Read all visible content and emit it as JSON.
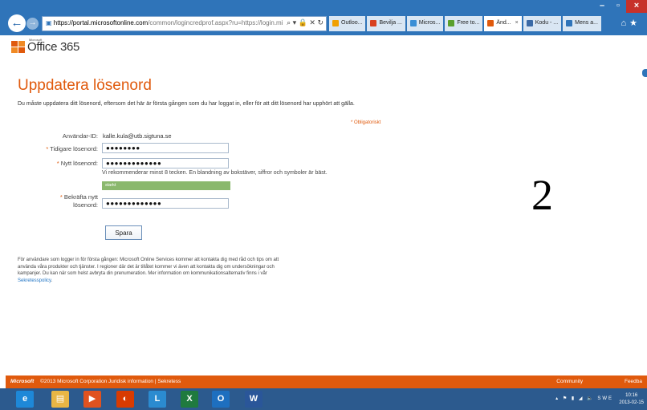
{
  "browser": {
    "url_host": "https://portal.microsoftonline.com",
    "url_rest": "/common/logincredprof.aspx?ru=https://login.mi",
    "tabs": [
      {
        "label": "Outloo...",
        "color": "#f0a000"
      },
      {
        "label": "Bevilja ...",
        "color": "#d8401f"
      },
      {
        "label": "Micros...",
        "color": "#3a8fd6"
      },
      {
        "label": "Free to...",
        "color": "#5aa02c"
      },
      {
        "label": "Änd...",
        "color": "#e05a0d"
      },
      {
        "label": "Kodu - ...",
        "color": "#3b6aa6"
      },
      {
        "label": "Mens a...",
        "color": "#2f74b9"
      }
    ],
    "tab_close": "×"
  },
  "header": {
    "logo_text": "Office 365",
    "logo_small": "Microsoft"
  },
  "page": {
    "title": "Uppdatera lösenord",
    "intro": "Du måste uppdatera ditt lösenord, eftersom det här är första gången som du har loggat in, eller för att ditt lösenord har upphört att gälla.",
    "required_note": "* Obligatoriskt",
    "user_id_label": "Användar-ID:",
    "user_id_value": "kalle.kula@utb.sigtuna.se",
    "old_pw_label": "Tidigare lösenord:",
    "old_pw_mask": "●●●●●●●●",
    "new_pw_label": "Nytt lösenord:",
    "new_pw_mask": "●●●●●●●●●●●●●",
    "hint": "Vi rekommenderar minst 8 tecken. En blandning av bokstäver, siffror och symboler är bäst.",
    "strength_label": "starkt",
    "strength_fraction": 1.0,
    "confirm_label_1": "Bekräfta nytt",
    "confirm_label_2": "lösenord:",
    "confirm_pw_mask": "●●●●●●●●●●●●●",
    "asterisk": "*",
    "save_label": "Spara",
    "footer_text": "För användare som logger in för första gången: Microsoft Online Services kommer att kontakta dig med råd och tips om att använda våra produkter och tjänster. I regioner där det är tillåtet kommer vi även att kontakta dig om undersökningar och kampanjer. Du kan när som helst avbryta din prenumeration. Mer information om kommunikationsalternativ finns i vår",
    "footer_link": "Sekretesspolicy",
    "annotation_number": "2"
  },
  "footer_bar": {
    "ms": "Microsoft",
    "copyright": "©2013 Microsoft Corporation  Juridisk information  |  Sekretess",
    "community": "Community",
    "feedback": "Feedba"
  },
  "taskbar": {
    "apps": [
      {
        "name": "ie-icon",
        "glyph": "e",
        "color": "#1e88d8"
      },
      {
        "name": "explorer-icon",
        "glyph": "▤",
        "color": "#e8b645"
      },
      {
        "name": "media-player-icon",
        "glyph": "▶",
        "color": "#e0521f"
      },
      {
        "name": "office-icon",
        "glyph": "◐",
        "color": "#d83b01"
      },
      {
        "name": "lync-icon",
        "glyph": "L",
        "color": "#2b8bd0"
      },
      {
        "name": "excel-icon",
        "glyph": "X",
        "color": "#1f7a3e"
      },
      {
        "name": "outlook-icon",
        "glyph": "O",
        "color": "#1e6fbf"
      },
      {
        "name": "word-icon",
        "glyph": "W",
        "color": "#2a5699"
      }
    ],
    "language": "SWE",
    "time": "10:16",
    "date": "2013-02-15"
  }
}
